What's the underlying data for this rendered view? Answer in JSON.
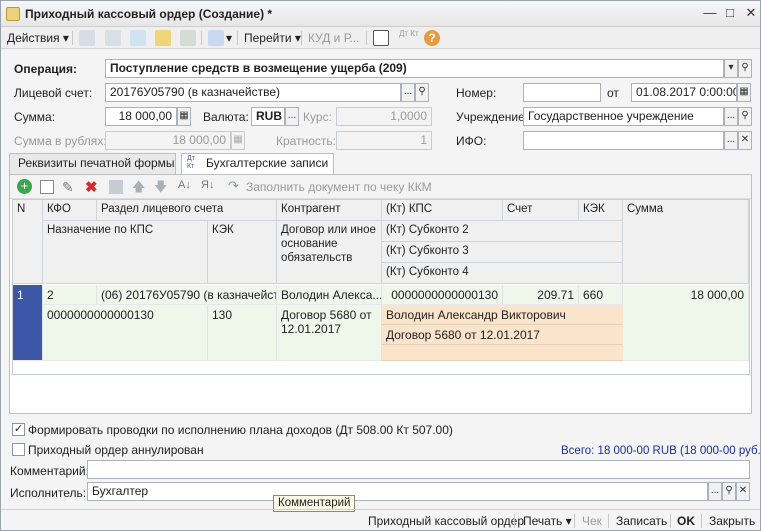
{
  "window": {
    "title": "Приходный кассовый ордер (Создание) *"
  },
  "toolbar": {
    "actions": "Действия",
    "goto": "Перейти",
    "kud": "КУД и Р...",
    "dtkt_icon": "Дт Кт",
    "help": "?"
  },
  "form": {
    "operation_label": "Операция:",
    "operation_value": "Поступление средств в возмещение ущерба (209)",
    "account_label": "Лицевой счет:",
    "account_value": "20176У05790 (в казначействе)",
    "number_label": "Номер:",
    "number_value": "",
    "date_from_label": "от",
    "date_value": "01.08.2017  0:00:00",
    "sum_label": "Сумма:",
    "sum_value": "18 000,00",
    "currency_label": "Валюта:",
    "currency_value": "RUB",
    "rate_label": "Курс:",
    "rate_value": "1,0000",
    "institution_label": "Учреждение:",
    "institution_value": "Государственное учреждение",
    "sum_rub_label": "Сумма в рублях:",
    "sum_rub_value": "18 000,00",
    "multiplicity_label": "Кратность:",
    "multiplicity_value": "1",
    "ifo_label": "ИФО:",
    "ifo_value": ""
  },
  "tabs": [
    {
      "label": "Реквизиты печатной формы"
    },
    {
      "label": "Бухгалтерские записи"
    }
  ],
  "grid_toolbar": {
    "fill_label": "Заполнить документ по чеку ККМ"
  },
  "table": {
    "headers": {
      "n": "N",
      "kfo": "КФО",
      "section": "Раздел лицевого счета",
      "contractor": "Контрагент",
      "kt_kps": "(Кт) КПС",
      "account": "Счет",
      "kek_top": "КЭК",
      "sum": "Сумма",
      "purpose": "Назначение по КПС",
      "kek": "КЭК",
      "contract": "Договор или иное основание обязательств",
      "subconto2": "(Кт) Субконто 2",
      "subconto3": "(Кт) Субконто 3",
      "subconto4": "(Кт) Субконто 4"
    },
    "rows": [
      {
        "n": "1",
        "kfo": "2",
        "section": "(06) 20176У05790 (в казначейст...",
        "contractor": "Володин Алекса...",
        "kt_kps": "0000000000000130",
        "account": "209.71",
        "kek_top": "660",
        "sum": "18 000,00",
        "purpose": "0000000000000130",
        "kek": "130",
        "contract": "Договор 5680 от 12.01.2017",
        "subconto2": "Володин Александр Викторович",
        "subconto3": "Договор 5680 от 12.01.2017",
        "subconto4": ""
      }
    ]
  },
  "options": {
    "form_entries": "Формировать проводки по исполнению плана доходов (Дт 508.00 Кт 507.00)",
    "form_entries_checked": true,
    "annulled": "Приходный ордер аннулирован",
    "annulled_checked": false,
    "total": "Всего: 18 000-00 RUB (18 000-00 руб.)"
  },
  "comment": {
    "label": "Комментарий:",
    "value": ""
  },
  "executor": {
    "label": "Исполнитель:",
    "value": "Бухгалтер"
  },
  "tooltip": "Комментарий",
  "footer": {
    "print_order": "Приходный кассовый ордер",
    "print": "Печать",
    "check": "Чек",
    "save": "Записать",
    "ok": "OK",
    "close": "Закрыть"
  },
  "colors": {
    "row_selected": "#3d57a8",
    "row_green": "#eef7ea",
    "subconto_bg": "#fbe4cc",
    "total_text": "#1a2f9c"
  }
}
